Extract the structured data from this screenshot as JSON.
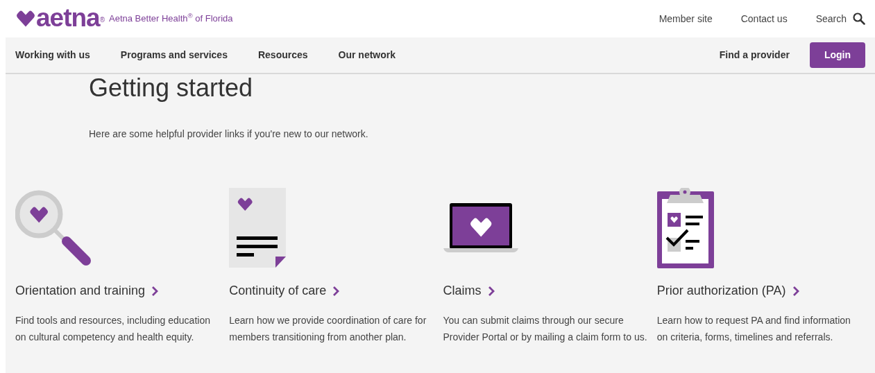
{
  "header": {
    "logo": {
      "wordmark": "aetna",
      "mark": "®"
    },
    "tagline": "Aetna Better Health$^{®}$ of Florida",
    "links": [
      "Member site",
      "Contact us"
    ],
    "search": "Search"
  },
  "nav": {
    "items": [
      "Working with us",
      "Programs and services",
      "Resources",
      "Our network"
    ],
    "find": "Find a provider",
    "login": "Login"
  },
  "page": {
    "title": "Getting started",
    "intro": "Here are some helpful provider links if you're new to our network."
  },
  "cards": [
    {
      "kind": "magnifier",
      "title": "Orientation and training",
      "text": "Find tools and resources, including education on cultural competency and health equity."
    },
    {
      "kind": "document",
      "title": "Continuity of care",
      "text": "Learn how we provide coordination of care for members transitioning from another plan."
    },
    {
      "kind": "laptop",
      "title": "Claims",
      "text": "You can submit claims through our secure Provider Portal or by mailing a claim form to us."
    },
    {
      "kind": "clipboard",
      "title": "Prior authorization (PA)",
      "text": "Learn how to request PA and find information on criteria, forms, timelines and referrals."
    }
  ]
}
